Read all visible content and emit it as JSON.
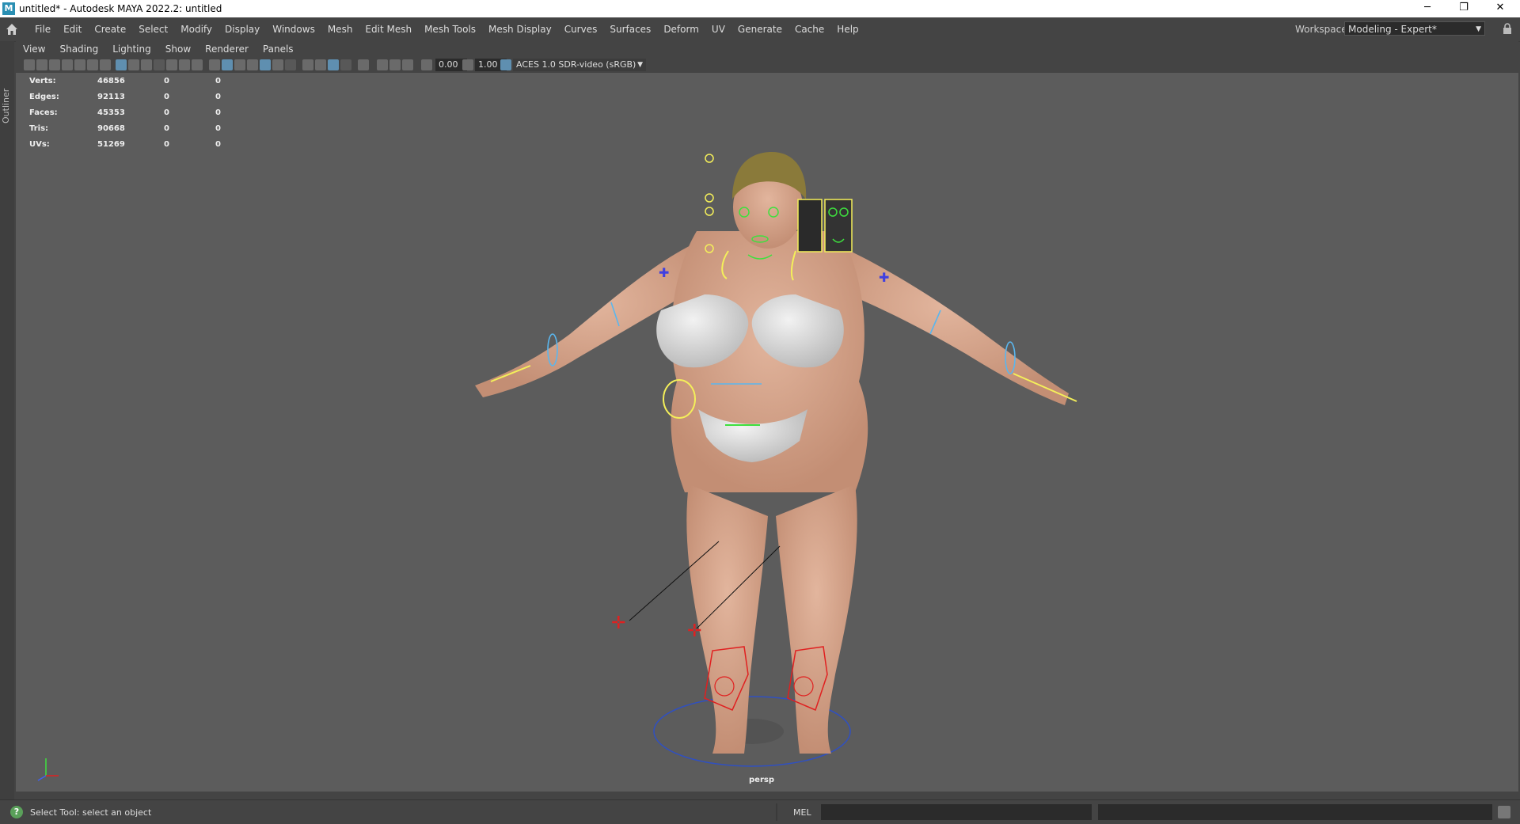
{
  "window": {
    "app_icon": "M",
    "title": "untitled* - Autodesk MAYA 2022.2: untitled",
    "minimize": "─",
    "restore": "❐",
    "close": "✕"
  },
  "menubar": {
    "home_icon": "home-icon",
    "items": [
      "File",
      "Edit",
      "Create",
      "Select",
      "Modify",
      "Display",
      "Windows",
      "Mesh",
      "Edit Mesh",
      "Mesh Tools",
      "Mesh Display",
      "Curves",
      "Surfaces",
      "Deform",
      "UV",
      "Generate",
      "Cache",
      "Help"
    ],
    "workspace_label": "Workspace:",
    "workspace_value": "Modeling - Expert*"
  },
  "outliner": {
    "label": "Outliner"
  },
  "panel_menu": [
    "View",
    "Shading",
    "Lighting",
    "Show",
    "Renderer",
    "Panels"
  ],
  "panel_toolbar": {
    "exposure": "0.00",
    "gamma": "1.00",
    "color_space": "ACES 1.0 SDR-video (sRGB)"
  },
  "hud": [
    {
      "label": "Verts:",
      "v1": "46856",
      "v2": "0",
      "v3": "0"
    },
    {
      "label": "Edges:",
      "v1": "92113",
      "v2": "0",
      "v3": "0"
    },
    {
      "label": "Faces:",
      "v1": "45353",
      "v2": "0",
      "v3": "0"
    },
    {
      "label": "Tris:",
      "v1": "90668",
      "v2": "0",
      "v3": "0"
    },
    {
      "label": "UVs:",
      "v1": "51269",
      "v2": "0",
      "v3": "0"
    }
  ],
  "viewport": {
    "camera": "persp",
    "axis_labels": [
      "x",
      "y",
      "z"
    ]
  },
  "statusbar": {
    "help_glyph": "?",
    "message": "Select Tool: select an object",
    "mel_label": "MEL"
  },
  "colors": {
    "ctrl_yellow": "#f4ef5a",
    "ctrl_blue": "#5ab6ee",
    "ctrl_red": "#e02020",
    "ctrl_green": "#3ee03e",
    "skin": "#d9a68c"
  }
}
